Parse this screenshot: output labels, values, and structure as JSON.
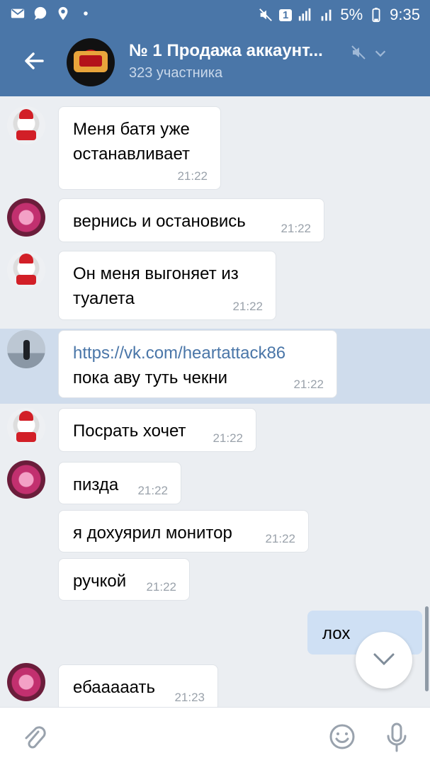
{
  "status_bar": {
    "battery": "5%",
    "time": "9:35",
    "sim": "1"
  },
  "header": {
    "title": "№ 1 Продажа аккаунт...",
    "subtitle": "323 участника"
  },
  "messages": [
    {
      "author": "cat",
      "lines": [
        "Меня батя уже",
        "останавливает"
      ],
      "time": "21:22"
    },
    {
      "author": "pink",
      "lines": [
        "вернись и остановись"
      ],
      "time": "21:22"
    },
    {
      "author": "cat",
      "lines": [
        "Он меня выгоняет из",
        "туалета"
      ],
      "time": "21:22"
    },
    {
      "author": "man",
      "link": "https://vk.com/heartattack86",
      "lines": [
        "пока аву туть чекни"
      ],
      "time": "21:22"
    },
    {
      "author": "cat",
      "lines": [
        "Посрать хочет"
      ],
      "time": "21:22"
    },
    {
      "author": "pink",
      "lines": [
        "пизда"
      ],
      "time": "21:22"
    },
    {
      "author": "pink",
      "lines": [
        "я дохуярил монитор"
      ],
      "time": "21:22"
    },
    {
      "author": "pink",
      "lines": [
        "ручкой"
      ],
      "time": "21:22"
    },
    {
      "author": "me",
      "lines": [
        "лох"
      ],
      "time": ""
    },
    {
      "author": "pink",
      "lines": [
        "ебааааать"
      ],
      "time": "21:23"
    }
  ],
  "icons": [
    "back-arrow-icon",
    "mute-icon",
    "chevron-down-icon",
    "paperclip-icon",
    "emoji-icon",
    "microphone-icon"
  ]
}
